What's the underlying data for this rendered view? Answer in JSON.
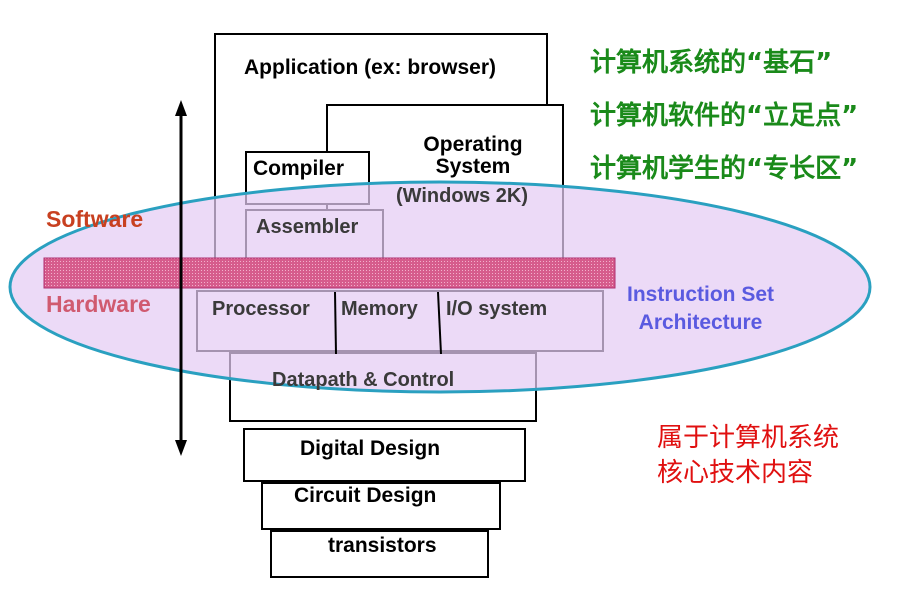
{
  "layers": {
    "application": "Application (ex: browser)",
    "operating_system_line1": "Operating",
    "operating_system_line2": "System",
    "operating_system_line3": "(Windows 2K)",
    "compiler": "Compiler",
    "assembler": "Assembler",
    "processor": "Processor",
    "memory": "Memory",
    "io_system": "I/O system",
    "datapath_control": "Datapath & Control",
    "digital_design": "Digital Design",
    "circuit_design": "Circuit Design",
    "transistors": "transistors"
  },
  "side_labels": {
    "software": "Software",
    "hardware": "Hardware"
  },
  "isa": {
    "line1": "Instruction Set",
    "line2": "Architecture"
  },
  "annotations": {
    "green": [
      "计算机系统的“基石”",
      "计算机软件的“立足点”",
      "计算机学生的“专长区”"
    ],
    "red": [
      "属于计算机系统",
      "核心技术内容"
    ]
  },
  "colors": {
    "software": "#c84020",
    "hardware": "#d05a70",
    "isa_text": "#5a5ae0",
    "ellipse_fill": "#e4ccf4",
    "ellipse_stroke": "#2aa0c0",
    "band": "#d65c8c",
    "green_text": "#1a8a1a",
    "red_text": "#e01010"
  }
}
